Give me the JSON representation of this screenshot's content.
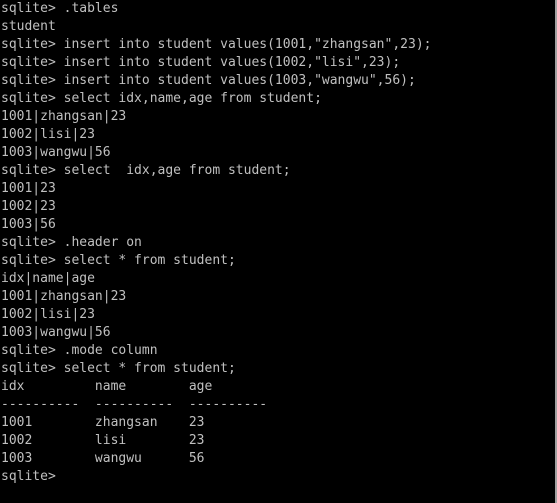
{
  "terminal": {
    "lines": [
      "sqlite> .tables",
      "student",
      "sqlite> insert into student values(1001,\"zhangsan\",23);",
      "sqlite> insert into student values(1002,\"lisi\",23);",
      "sqlite> insert into student values(1003,\"wangwu\",56);",
      "sqlite> select idx,name,age from student;",
      "1001|zhangsan|23",
      "1002|lisi|23",
      "1003|wangwu|56",
      "sqlite> select  idx,age from student;",
      "1001|23",
      "1002|23",
      "1003|56",
      "sqlite> .header on",
      "sqlite> select * from student;",
      "idx|name|age",
      "1001|zhangsan|23",
      "1002|lisi|23",
      "1003|wangwu|56",
      "sqlite> .mode column",
      "sqlite> select * from student;",
      "idx         name        age",
      "----------  ----------  ----------",
      "1001        zhangsan    23",
      "1002        lisi        23",
      "1003        wangwu      56",
      "sqlite>"
    ]
  }
}
